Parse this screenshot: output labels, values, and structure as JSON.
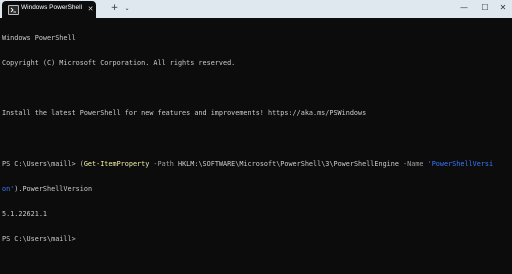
{
  "tab": {
    "title": "Windows PowerShell",
    "close_glyph": "✕"
  },
  "tabbar": {
    "new_tab_glyph": "+",
    "dropdown_glyph": "⌄"
  },
  "window_controls": {
    "minimize_glyph": "—",
    "maximize_glyph": "☐",
    "close_glyph": "✕"
  },
  "terminal": {
    "header_line1": "Windows PowerShell",
    "header_line2": "Copyright (C) Microsoft Corporation. All rights reserved.",
    "header_line3": "Install the latest PowerShell for new features and improvements! https://aka.ms/PSWindows",
    "prompt": "PS C:\\Users\\maill> ",
    "cmd_open": "(",
    "cmd_name": "Get-ItemProperty",
    "cmd_param_path": " -Path ",
    "cmd_path_value": "HKLM:\\SOFTWARE\\Microsoft\\PowerShell\\3\\PowerShellEngine",
    "cmd_param_name": " -Name ",
    "cmd_name_value_part1": "'PowerShellVersi",
    "cmd_name_value_part2": "on'",
    "cmd_tail": ").PowerShellVersion",
    "output": "5.1.22621.1",
    "prompt2": "PS C:\\Users\\maill>"
  },
  "colors": {
    "background": "#0c0c0c",
    "text": "#cccccc",
    "command": "#f9f1a5",
    "parameter": "#a0a0a0",
    "string": "#3b78ff",
    "tabbar": "#dfe7ef"
  }
}
